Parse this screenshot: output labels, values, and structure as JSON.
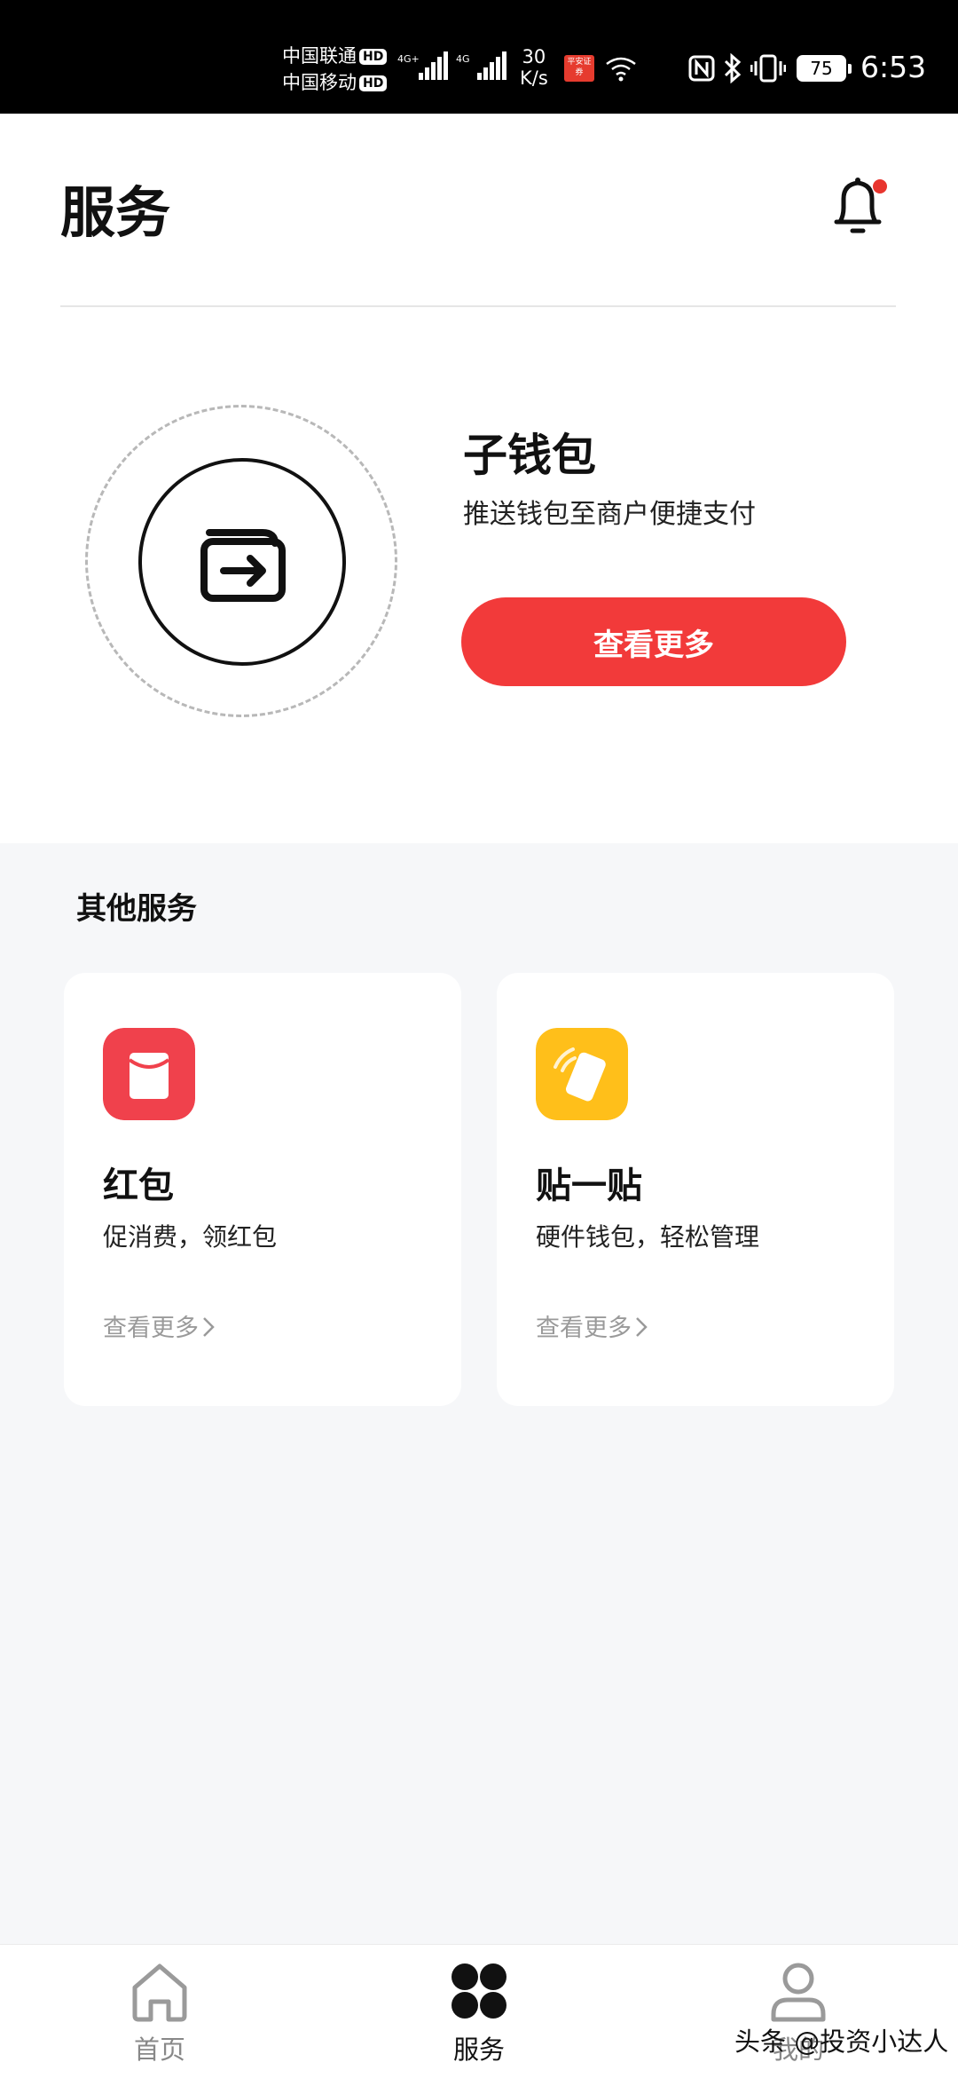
{
  "status_bar": {
    "carrier_1": "中国联通",
    "carrier_2": "中国移动",
    "hd_badge": "HD",
    "network_1": "4G+",
    "network_2": "4G",
    "speed_value": "30",
    "speed_unit": "K/s",
    "app_badge": "平安证券",
    "battery": "75",
    "time": "6:53"
  },
  "header": {
    "title": "服务",
    "notification_dot_color": "#e8352e"
  },
  "hero": {
    "title": "子钱包",
    "subtitle": "推送钱包至商户便捷支付",
    "cta_label": "查看更多",
    "cta_color": "#f23a3a"
  },
  "other_services": {
    "title": "其他服务",
    "cards": [
      {
        "icon": "red-envelope-icon",
        "icon_color": "#f0414c",
        "title": "红包",
        "subtitle": "促消费，领红包",
        "more_label": "查看更多"
      },
      {
        "icon": "tap-card-icon",
        "icon_color": "#ffbf1a",
        "title": "贴一贴",
        "subtitle": "硬件钱包，轻松管理",
        "more_label": "查看更多"
      }
    ]
  },
  "bottom_nav": {
    "items": [
      {
        "label": "首页",
        "icon": "home-icon",
        "active": false
      },
      {
        "label": "服务",
        "icon": "services-icon",
        "active": true
      },
      {
        "label": "我的",
        "icon": "profile-icon",
        "active": false
      }
    ]
  },
  "watermark": "头条 @投资小达人"
}
